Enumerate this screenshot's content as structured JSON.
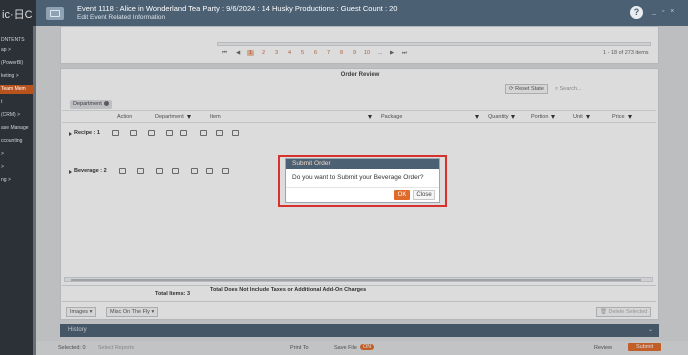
{
  "sidebar": {
    "logo": "ic·日C",
    "items": [
      {
        "label": "DNTENTS"
      },
      {
        "label": "ap >"
      },
      {
        "label": "(PowerBI)"
      },
      {
        "label": "keting >"
      },
      {
        "label": "Team Mem"
      },
      {
        "label": "t"
      },
      {
        "label": "(CRM) >"
      },
      {
        "label": "ase Manage"
      },
      {
        "label": "ccounting"
      },
      {
        "label": ">"
      },
      {
        "label": ">"
      },
      {
        "label": "ng >"
      }
    ]
  },
  "header": {
    "title": "Event 1118 : Alice in Wonderland Tea Party : 9/6/2024 : 14 Husky Productions : Guest Count : 20",
    "subtitle": "Edit Event Related Information",
    "help_label": "?",
    "window_controls": "_ ▫ ×"
  },
  "top_panel": {
    "pagination": {
      "first": "⏮",
      "prev": "◀",
      "pages": [
        "1",
        "2",
        "3",
        "4",
        "5",
        "6",
        "7",
        "8",
        "9",
        "10",
        "..."
      ],
      "next": "▶",
      "last": "⏭",
      "range": "1 - 18 of 273 items"
    }
  },
  "order_review": {
    "title": "Order Review",
    "reset_label": "Reset State",
    "search_placeholder": "Search...",
    "group_chip": "Department",
    "columns": [
      "Action",
      "Department",
      "Item",
      "Package",
      "Quantity",
      "Portion",
      "Unit",
      "Price"
    ],
    "groups": [
      {
        "label": "Recipe : 1"
      },
      {
        "label": "Beverage : 2"
      }
    ],
    "totals": {
      "items": "Total Items: 3",
      "note": "Total Does Not Include Taxes or Additional Add-On Charges"
    },
    "images_label": "Images",
    "misc_label": "Misc On The Fly",
    "delete_label": "Delete Selected"
  },
  "history": {
    "title": "History",
    "collapse": "⌄"
  },
  "footer": {
    "selected": "Selected: 0",
    "select_reports": "Select Reports",
    "print_to": "Print To",
    "save_file": "Save File",
    "toggle": "ON",
    "review": "Review",
    "submit": "Submit"
  },
  "dialog": {
    "title": "Submit Order",
    "message": "Do you want to Submit your Beverage Order?",
    "ok_label": "OK",
    "close_label": "Close"
  },
  "colors": {
    "header_bg": "#4c6073",
    "accent": "#e06a2a",
    "highlight": "#d8322f"
  }
}
